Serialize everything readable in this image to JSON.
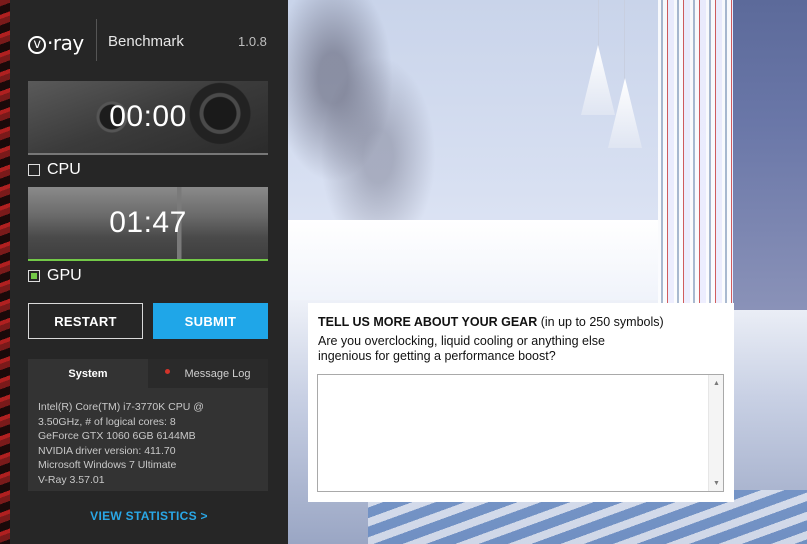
{
  "app": {
    "logo_text": "v·ray",
    "logo_v": "v",
    "logo_rest": "·ray",
    "product": "Benchmark",
    "version": "1.0.8"
  },
  "tests": {
    "cpu": {
      "timer": "00:00",
      "label": "CPU",
      "checked": false
    },
    "gpu": {
      "timer": "01:47",
      "label": "GPU",
      "checked": true
    }
  },
  "buttons": {
    "restart": "RESTART",
    "submit": "SUBMIT",
    "view_statistics": "VIEW STATISTICS >"
  },
  "info_tabs": {
    "system": "System",
    "message_log": "Message Log"
  },
  "system_info": {
    "lines": [
      "Intel(R) Core(TM) i7-3770K CPU @",
      "3.50GHz, # of logical cores: 8",
      "GeForce GTX 1060 6GB 6144MB",
      "NVIDIA driver version: 411.70",
      "Microsoft Windows 7 Ultimate",
      "V-Ray 3.57.01"
    ]
  },
  "feedback": {
    "title": "TELL US MORE ABOUT YOUR GEAR",
    "title_note": " (in up to 250 symbols)",
    "question_line1": "Are you overclocking, liquid cooling or anything else",
    "question_line2": "ingenious for getting a performance boost?",
    "textarea_value": ""
  },
  "colors": {
    "accent_blue": "#1fa6e8",
    "progress_green": "#73c948",
    "panel_bg": "#262626",
    "log_dot": "#d2342a"
  }
}
